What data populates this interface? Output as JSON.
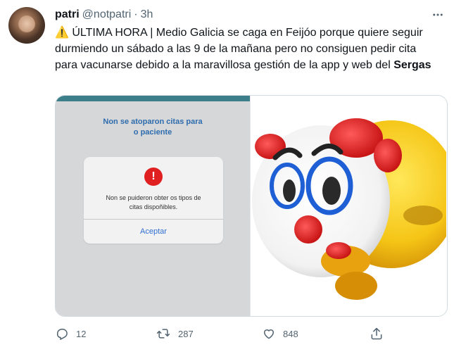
{
  "tweet": {
    "display_name": "patri",
    "handle": "@notpatri",
    "separator": "·",
    "time": "3h",
    "warning_emoji": "⚠️",
    "text_main": " ÚLTIMA HORA | Medio Galicia se caga en Feijóo porque quiere seguir durmiendo un sábado a las 9 de la mañana pero no consiguen pedir cita para vacunarse debido a la maravillosa gestión de la app y web del ",
    "text_bold": "Sergas"
  },
  "media": {
    "screenshot": {
      "subtitle_line1": "Non se atoparon citas para",
      "subtitle_line2": "o paciente",
      "dialog": {
        "alert_symbol": "!",
        "message_line1": "Non se puideron obter os tipos de",
        "message_line2": "citas dispoñibles.",
        "accept_label": "Aceptar"
      }
    },
    "image_right": {
      "icon": "clown-emoji-meme"
    }
  },
  "actions": {
    "reply_count": "12",
    "retweet_count": "287",
    "like_count": "848"
  },
  "colors": {
    "text": "#0f1419",
    "secondary": "#536471",
    "link_blue": "#2f6fd1",
    "alert_red": "#e02020",
    "app_blue": "#2e6cae"
  }
}
